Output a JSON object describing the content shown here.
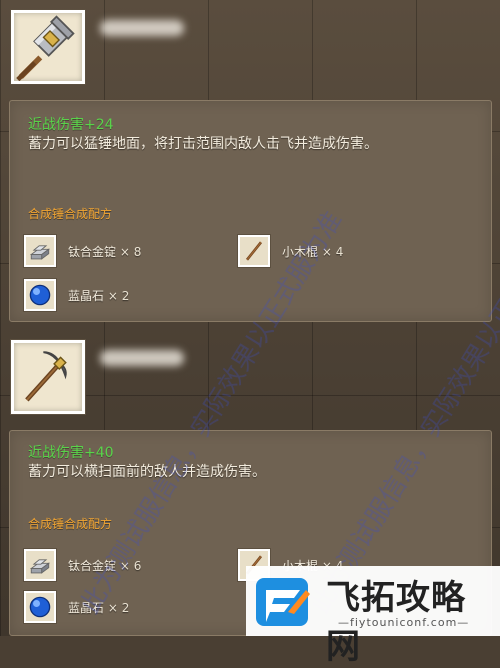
{
  "items": [
    {
      "icon": "warhammer-icon",
      "damage": "近战伤害+24",
      "description": "蓄力可以猛锤地面，将打击范围内敌人击飞并造成伤害。",
      "recipe_title": "合成锤合成配方",
      "materials": [
        {
          "icon": "titanium-ingot-icon",
          "name": "钛合金锭",
          "qty": "× 8"
        },
        {
          "icon": "wood-stick-icon",
          "name": "小木棍",
          "qty": "× 4"
        },
        {
          "icon": "blue-crystal-icon",
          "name": "蓝晶石",
          "qty": "× 2"
        }
      ]
    },
    {
      "icon": "scythe-pick-icon",
      "damage": "近战伤害+40",
      "description": "蓄力可以横扫面前的敌人并造成伤害。",
      "recipe_title": "合成锤合成配方",
      "materials": [
        {
          "icon": "titanium-ingot-icon",
          "name": "钛合金锭",
          "qty": "× 6"
        },
        {
          "icon": "wood-stick-icon",
          "name": "小木棍",
          "qty": "× 4"
        },
        {
          "icon": "blue-crystal-icon",
          "name": "蓝晶石",
          "qty": "× 2"
        }
      ]
    }
  ],
  "watermarks": [
    "此为测试服信息，实际效果以正式服为准",
    "此为测试服信息，实际效果以正式服为准"
  ],
  "site_logo": {
    "name": "飞拓攻略网",
    "url": "—fiytouniconf.com—"
  },
  "colors": {
    "damage_green": "#59d34a",
    "recipe_orange": "#f1a431",
    "panel_brown": "#6f6252"
  }
}
